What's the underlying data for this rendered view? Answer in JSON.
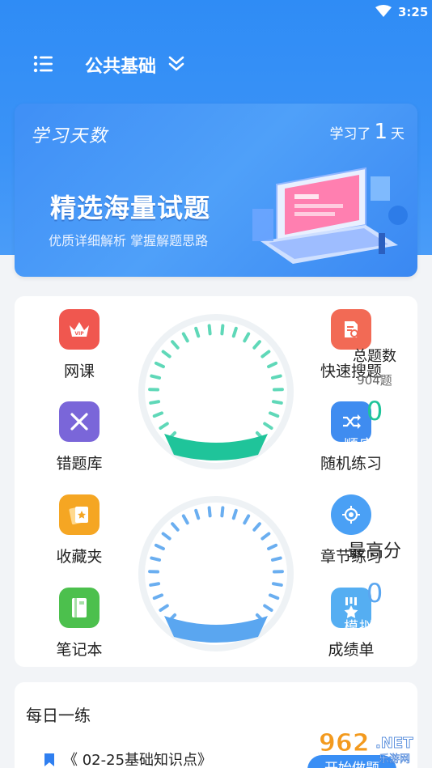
{
  "status_bar": {
    "time": "3:25"
  },
  "nav": {
    "title": "公共基础"
  },
  "banner": {
    "study_days_label": "学习天数",
    "study_prefix": "学习了",
    "study_days": "1",
    "study_suffix": "天",
    "headline": "精选海量试题",
    "subline": "优质详细解析 掌握解题思路"
  },
  "features": {
    "left": [
      {
        "label": "网课",
        "icon": "vip-crown-icon"
      },
      {
        "label": "错题库",
        "icon": "close-x-icon"
      },
      {
        "label": "收藏夹",
        "icon": "star-cards-icon"
      },
      {
        "label": "笔记本",
        "icon": "notebook-icon"
      }
    ],
    "right": [
      {
        "label": "快速搜题",
        "icon": "doc-search-icon"
      },
      {
        "label": "随机练习",
        "icon": "shuffle-icon"
      },
      {
        "label": "章节练习",
        "icon": "target-icon"
      },
      {
        "label": "成绩单",
        "icon": "medal-icon"
      }
    ],
    "dial_practice": {
      "title": "总题数",
      "count": "904题",
      "score": "0",
      "button": "顺序练习"
    },
    "dial_exam": {
      "title": "最高分",
      "score": "0",
      "button": "模拟考试"
    }
  },
  "daily": {
    "title": "每日一练",
    "item": "《 02-25基础知识点》",
    "button": "开始做题"
  },
  "watermark": {
    "brand": "962",
    "suffix": ".NET",
    "sub": "乐游网"
  },
  "colors": {
    "primary": "#3a8ff5",
    "teal": "#1fc49a",
    "red": "#f0574f",
    "purple": "#7a66d9",
    "orange": "#f5a623",
    "green": "#4cc04d",
    "blue_icon": "#4aa0f5"
  }
}
